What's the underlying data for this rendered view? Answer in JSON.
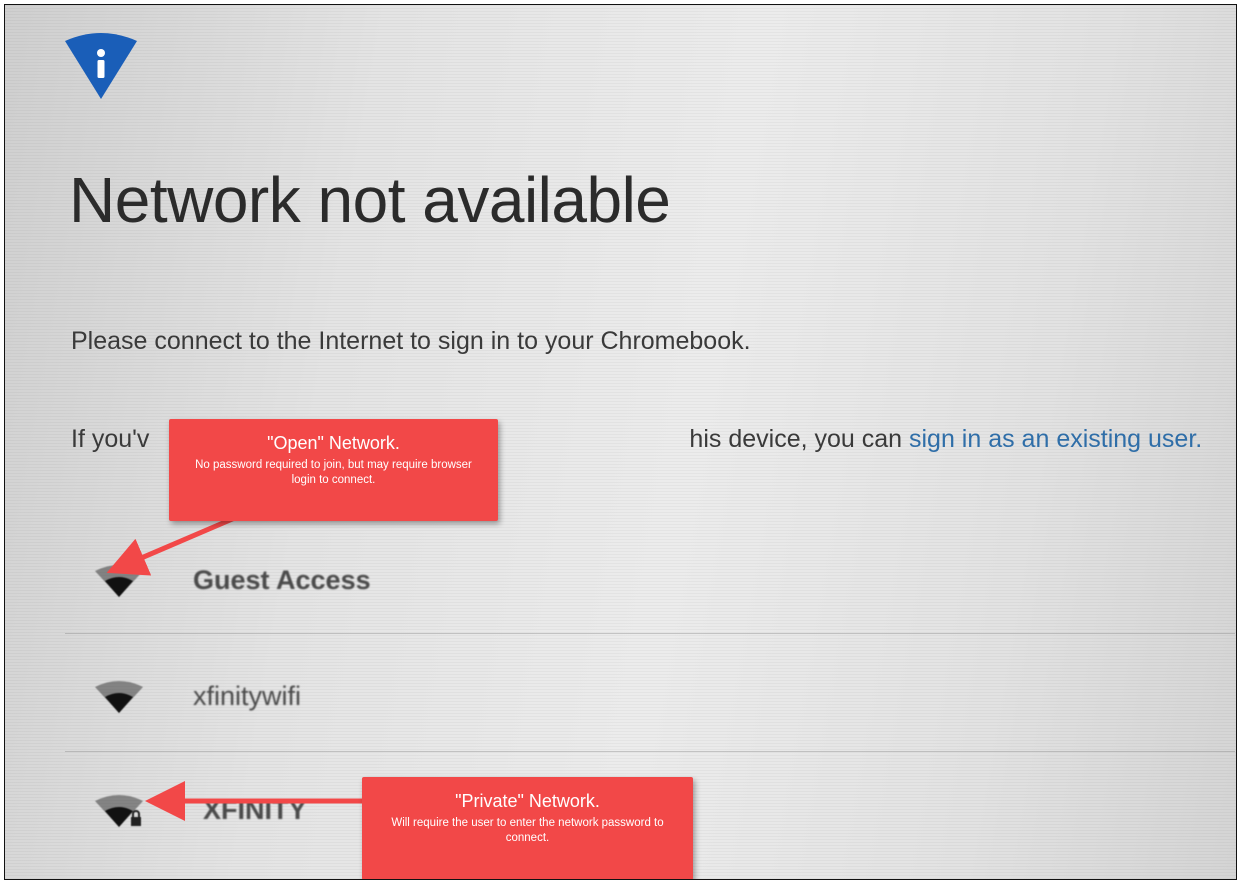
{
  "header": {
    "icon": "wifi-info-icon",
    "icon_color": "#1a5eb8"
  },
  "page": {
    "title": "Network not available",
    "prompt": "Please connect to the Internet to sign in to your Chromebook.",
    "existing_prefix": "If you'v",
    "existing_suffix": "his device, you can ",
    "existing_link": "sign in as an existing user."
  },
  "networks": [
    {
      "name": "Guest Access",
      "icon": "wifi-icon",
      "secured": false
    },
    {
      "name": "xfinitywifi",
      "icon": "wifi-icon",
      "secured": false
    },
    {
      "name": "XFINITY",
      "icon": "wifi-lock-icon",
      "secured": true
    }
  ],
  "callouts": {
    "open": {
      "title": "\"Open\" Network.",
      "text": "No password required to join, but may require browser login to connect."
    },
    "private": {
      "title": "\"Private\" Network.",
      "text": "Will require the user to enter the network password to connect."
    }
  },
  "colors": {
    "callout": "#f24848",
    "link": "#2f6ea8",
    "brand": "#1a5eb8"
  }
}
